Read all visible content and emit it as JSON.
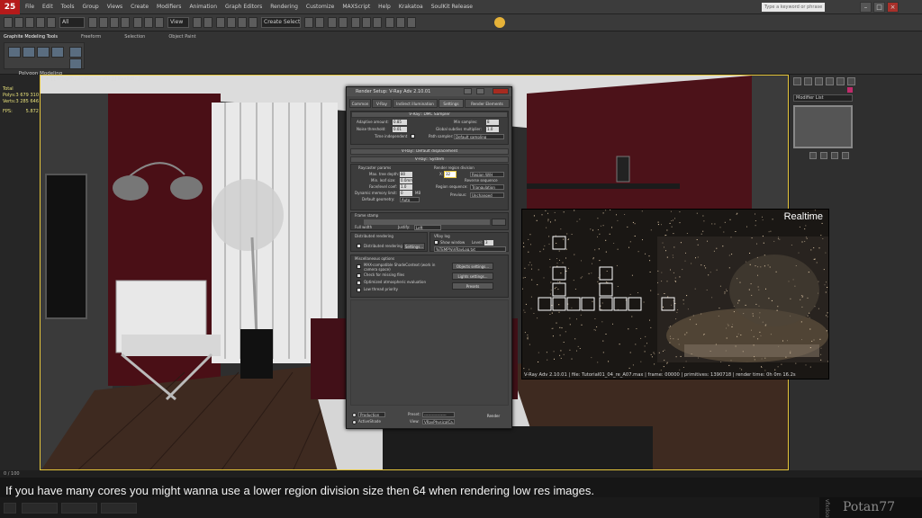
{
  "app": {
    "logo": "25",
    "menus": [
      "File",
      "Edit",
      "Tools",
      "Group",
      "Views",
      "Create",
      "Modifiers",
      "Animation",
      "Graph Editors",
      "Rendering",
      "Customize",
      "MAXScript",
      "Help",
      "Krakatoa",
      "SoulKit Release"
    ],
    "search_placeholder": "Type a keyword or phrase"
  },
  "toolbar": {
    "selection_filter": "All",
    "view_dropdown": "View",
    "selection_set": "Create Selection Se"
  },
  "ribbon": {
    "tabs": [
      "Graphite Modeling Tools",
      "Freeform",
      "Selection",
      "Object Paint"
    ],
    "group_label": "Polygon Modeling"
  },
  "stats": {
    "title": "Total",
    "polys_label": "Polys:",
    "polys_value": "3 679 310",
    "verts_label": "Verts:",
    "verts_value": "3 285 646",
    "fps_label": "FPS:",
    "fps_value": "5.872"
  },
  "viewport": {
    "label": "[ + ] [ VRayPhysicalCamera01 ] [ Realistic ]"
  },
  "command_panel": {
    "modifier_list": "Modifier List"
  },
  "render_dialog": {
    "title": "Render Setup: V-Ray Adv 2.10.01",
    "tabs": [
      "Common",
      "V-Ray",
      "Indirect illumination",
      "Settings",
      "Render Elements"
    ],
    "dmc_header": "V-Ray:: DMC Sampler",
    "adaptive_amount_label": "Adaptive amount:",
    "adaptive_amount": "0.85",
    "noise_threshold_label": "Noise threshold:",
    "noise_threshold": "0.01",
    "time_independent_label": "Time independent",
    "min_samples_label": "Min samples:",
    "min_samples": "8",
    "global_subdivs_label": "Global subdivs multiplier:",
    "global_subdivs": "1.0",
    "path_sampler_label": "Path sampler:",
    "path_sampler": "Default sampling",
    "displacement_header": "V-Ray:: Default displacement",
    "system_header": "V-Ray:: System",
    "raycaster_label": "Raycaster params",
    "max_tree_depth_label": "Max. tree depth:",
    "max_tree_depth": "80",
    "min_leaf_label": "Min. leaf size:",
    "min_leaf": "0.0mm",
    "face_level_label": "Face/level coef:",
    "face_level": "1.0",
    "dyn_mem_label": "Dynamic memory limit:",
    "dyn_mem": "0",
    "mb_unit": "MB",
    "default_geometry_label": "Default geometry:",
    "default_geometry": "Auto",
    "region_division_label": "Render region division",
    "region_x_label": "X:",
    "region_x": "32",
    "region_mode": "Region W/H",
    "reverse_sequence_label": "Reverse sequence",
    "region_sequence_label": "Region sequence:",
    "region_sequence": "Triangulation",
    "previous_label": "Previous:",
    "previous": "Unchanged",
    "frame_stamp_label": "Frame stamp",
    "vfb_label": "Full width",
    "justify_label": "Justify:",
    "justify": "Left",
    "distributed_header": "Distributed rendering",
    "distributed_label": "Distributed rendering",
    "settings_btn": "Settings...",
    "vray_log_label": "VRay log",
    "show_window_label": "Show window",
    "level_label": "Level:",
    "level": "3",
    "log_path": "%TEMP%\\VRayLog.txt",
    "misc_header": "Miscellaneous options",
    "misc_options": [
      "MAX-compatible ShadeContext (work in camera space)",
      "Check for missing files",
      "Optimized atmospheric evaluation",
      "Low thread priority"
    ],
    "objects_settings_btn": "Objects settings...",
    "lights_settings_btn": "Lights settings...",
    "presets_btn": "Presets",
    "mode_label": "Production",
    "activeshade_label": "ActiveShade",
    "preset_label": "Preset:",
    "preset_value": "-----------------",
    "view_label": "View:",
    "view_value": "VRayPhysicalCa...",
    "render_btn": "Render"
  },
  "realtime": {
    "label": "Realtime",
    "info": "V-Ray Adv 2.10.01 | file: Tutorial01_04_re_A07.max | frame: 00000 | primitives: 1390718 | render time: 0h 0m 16.2s"
  },
  "bottom": {
    "coord": "0 / 100"
  },
  "subtitle": "If you have many cores you might wanna use a lower region division size then 64 when rendering low res images.",
  "watermark": "Potan77",
  "watermark_small": "vfxdoom"
}
